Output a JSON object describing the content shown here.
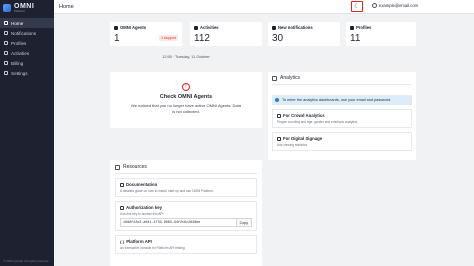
{
  "brand": {
    "name": "OMNI",
    "sub": "Platform"
  },
  "sidebar": {
    "items": [
      {
        "label": "Home",
        "icon": "home-icon",
        "active": true
      },
      {
        "label": "Notifications",
        "icon": "bell-icon",
        "active": false
      },
      {
        "label": "Profiles",
        "icon": "profile-icon",
        "active": false
      },
      {
        "label": "Activities",
        "icon": "activity-icon",
        "active": false
      },
      {
        "label": "Billing",
        "icon": "card-icon",
        "active": false
      },
      {
        "label": "Settings",
        "icon": "gear-icon",
        "active": false
      }
    ],
    "footer": "© 2023 Quividi. All rights reserved."
  },
  "topbar": {
    "title": "Home",
    "user_email": "example@email.com",
    "theme_icon": "moon-icon"
  },
  "stats": [
    {
      "label": "OMNI Agents",
      "value": "1",
      "badge": "1 stopped"
    },
    {
      "label": "Activities",
      "value": "112"
    },
    {
      "label": "New notifications",
      "value": "30"
    },
    {
      "label": "Profiles",
      "value": "11"
    }
  ],
  "timestamp": "12:55 · Tuesday, 11 October",
  "check": {
    "title": "Check OMNI Agents",
    "message": "We noticed that you no longer have active OMNI Agents. Data is not collected."
  },
  "analytics": {
    "title": "Analytics",
    "info": "To enter the analytics dashboards, use your email and password.",
    "cards": [
      {
        "title": "For Crowd Analytics",
        "desc": "People counting and age, gender and emotions analytics"
      },
      {
        "title": "For Digital Signage",
        "desc": "Ads viewing statistics"
      }
    ]
  },
  "resources": {
    "title": "Resources",
    "documentation": {
      "title": "Documentation",
      "desc": "A detailed guide on how to install, start up and use OMNI Platform."
    },
    "auth": {
      "title": "Authorization key",
      "desc": "Use this key to access this API",
      "key": "1988f22e3-a041-4733-9063-94f2c6c2848be",
      "copy_label": "Copy"
    },
    "api": {
      "title": "Platform API",
      "desc": "An interactive console for Platform API testing"
    }
  },
  "colors": {
    "sidebar_bg": "#1d2130",
    "accent_red": "#e0241b",
    "info_bg": "#dcecf9"
  }
}
